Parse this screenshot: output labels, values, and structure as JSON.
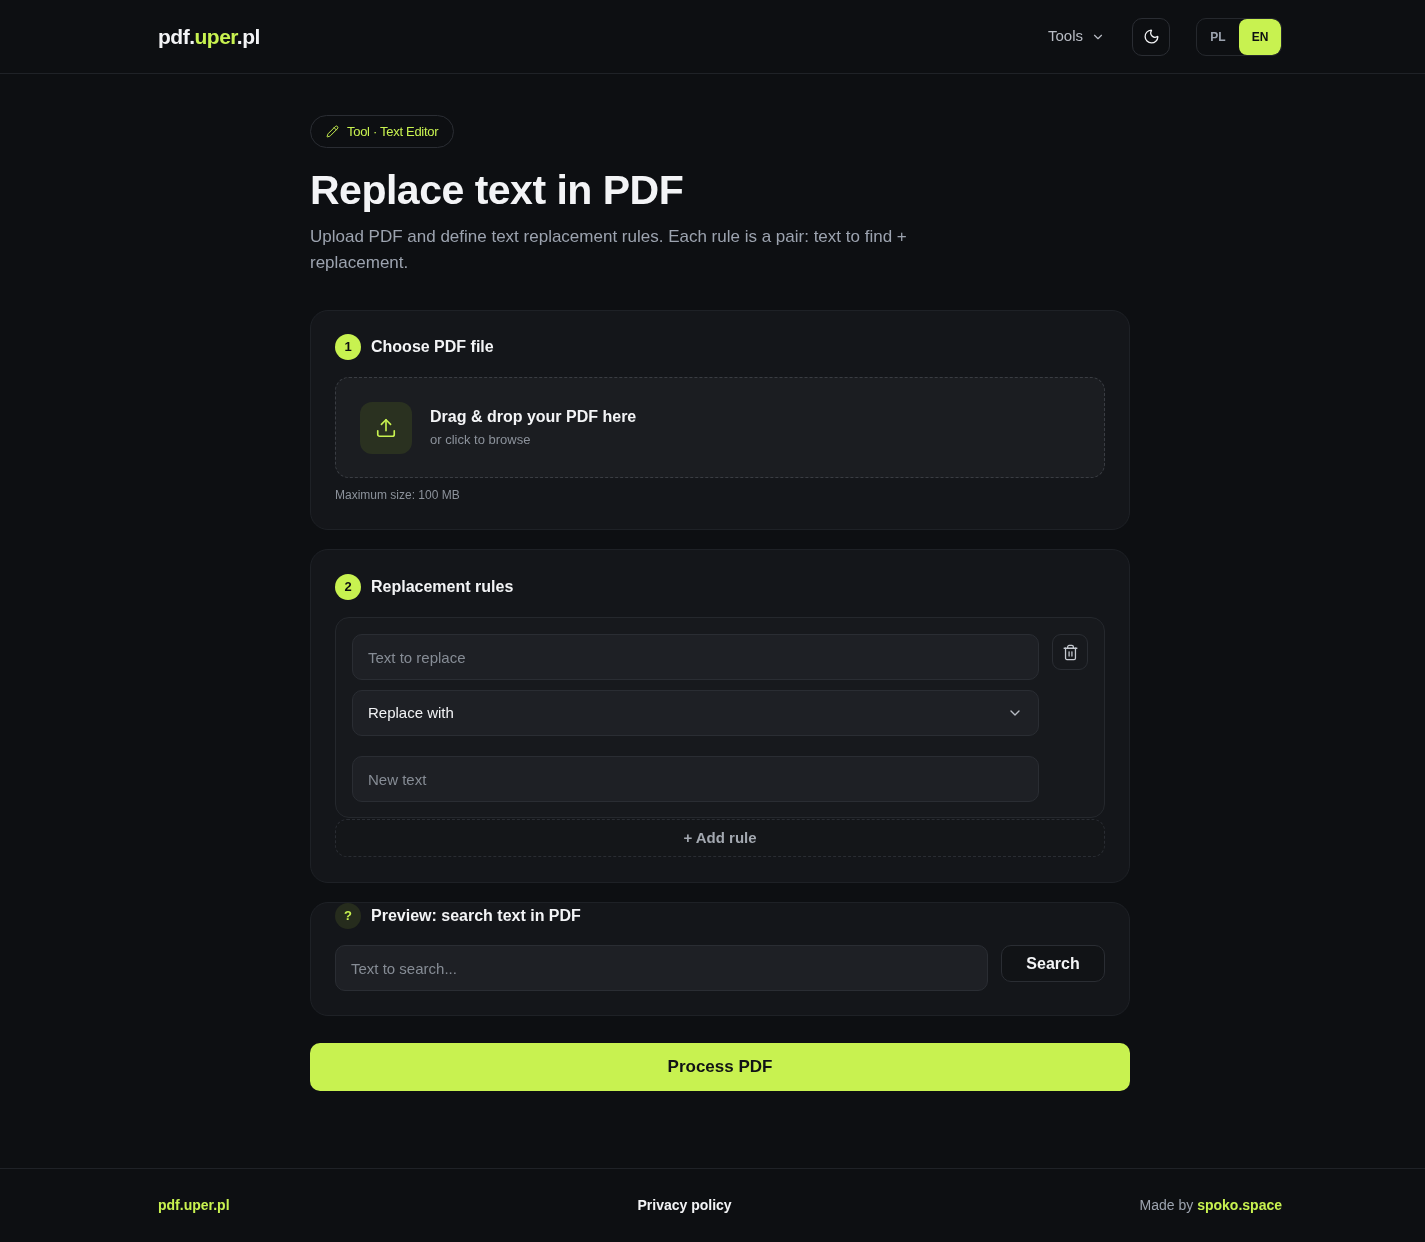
{
  "header": {
    "logo": [
      {
        "text": "pdf.",
        "accent": false
      },
      {
        "text": "uper",
        "accent": true
      },
      {
        "text": ".pl",
        "accent": false
      }
    ],
    "nav": {
      "label": "Tools"
    },
    "languages": [
      {
        "label": "PL",
        "selected": false
      },
      {
        "label": "EN",
        "selected": true
      }
    ]
  },
  "badge": {
    "label": "Tool · Text Editor"
  },
  "title": "Replace text in PDF",
  "description": "Upload PDF and define text replacement rules. Each rule is a pair: text to find + replacement.",
  "steps": [
    {
      "kind": "upload",
      "number": "1",
      "muted": false,
      "title": "Choose PDF file",
      "dropzone": {
        "title": "Drag & drop your PDF here",
        "subtitle": "or click to browse"
      },
      "note": "Maximum size: 100 MB"
    },
    {
      "kind": "rules",
      "number": "2",
      "muted": false,
      "title": "Replacement rules",
      "rules": [
        {
          "find": {
            "placeholder": "Text to replace"
          },
          "mode": {
            "value": "Replace with"
          },
          "replacement": {
            "placeholder": "New text"
          }
        }
      ],
      "add_button": "+ Add rule"
    },
    {
      "kind": "search",
      "number": "?",
      "muted": true,
      "title": "Preview: search text in PDF",
      "field": {
        "placeholder": "Text to search..."
      },
      "button": "Search"
    }
  ],
  "submit": "Process PDF",
  "footer": {
    "brand": "pdf.uper.pl",
    "link": "Privacy policy",
    "credit": "Made by",
    "credit_link": "spoko.space"
  }
}
